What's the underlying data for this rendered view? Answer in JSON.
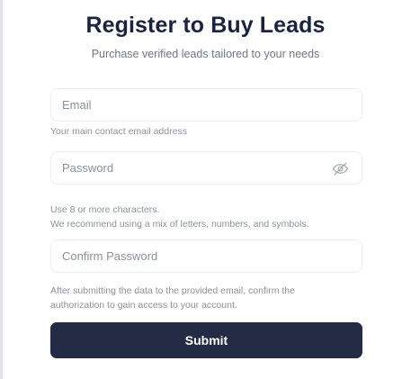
{
  "header": {
    "title": "Register to Buy Leads",
    "subtitle": "Purchase verified leads tailored to your needs"
  },
  "form": {
    "email": {
      "placeholder": "Email",
      "value": "",
      "help": "Your main contact email address"
    },
    "password": {
      "placeholder": "Password",
      "value": "",
      "help_line1": "Use 8 or more characters.",
      "help_line2": "We recommend using a mix of letters, numbers, and symbols."
    },
    "confirm_password": {
      "placeholder": "Confirm Password",
      "value": "",
      "help_line1": "After submitting the data to the provided email, confirm the",
      "help_line2": "authorization to gain access to your account."
    },
    "submit_label": "Submit"
  },
  "icons": {
    "password_toggle": "eye-off-icon"
  },
  "colors": {
    "primary": "#232b45",
    "title": "#1a2340",
    "muted": "#8b919c",
    "border": "#eceef2"
  }
}
